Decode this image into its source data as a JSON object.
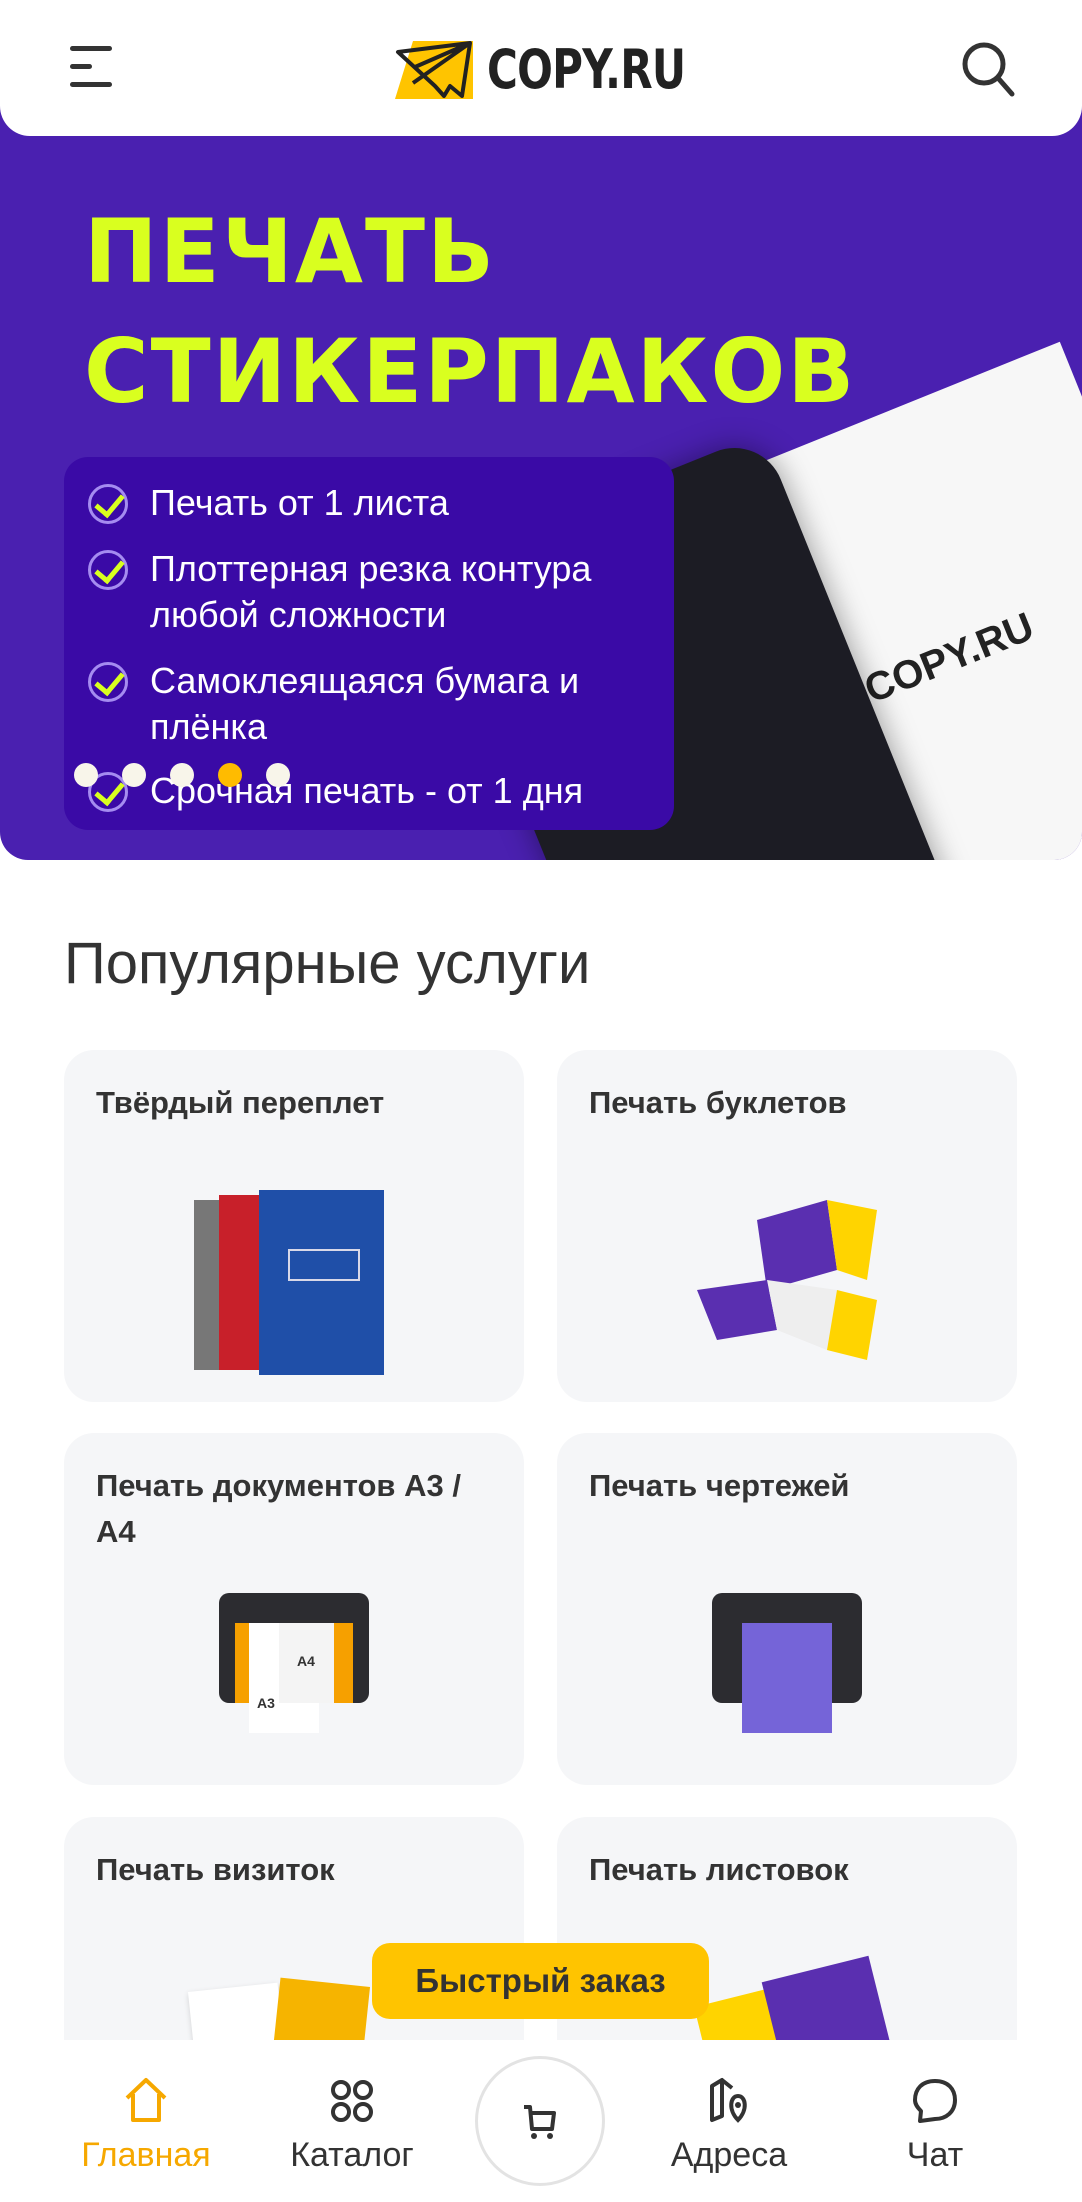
{
  "header": {
    "logo_text": "COPY.RU",
    "menu_icon": "hamburger-icon",
    "search_icon": "search-icon"
  },
  "banner": {
    "title_line1": "ПЕЧАТЬ",
    "title_line2": "СТИКЕРПАКОВ",
    "features": [
      "Печать от 1 листа",
      "Плоттерная резка контура любой сложности",
      "Самоклеящаяся бумага и плёнка",
      "Срочная печать - от 1 дня"
    ],
    "sheet_logo": "COPY.RU",
    "slides_count": 5,
    "active_slide": 4,
    "colors": {
      "background": "#4a20b0",
      "title": "#d9ff1f",
      "active_dot": "#ffbb00"
    }
  },
  "popular": {
    "title": "Популярные услуги",
    "cards": [
      {
        "title": "Твёрдый переплет"
      },
      {
        "title": "Печать буклетов"
      },
      {
        "title": "Печать документов А3 / А4"
      },
      {
        "title": "Печать чертежей"
      },
      {
        "title": "Печать визиток"
      },
      {
        "title": "Печать листовок"
      }
    ],
    "printer_labels": {
      "a4": "A4",
      "a3": "A3"
    }
  },
  "quick_order": {
    "label": "Быстрый заказ",
    "color": "#ffc400"
  },
  "nav": {
    "items": [
      {
        "label": "Главная",
        "icon": "home-icon",
        "active": true
      },
      {
        "label": "Каталог",
        "icon": "grid-icon"
      },
      {
        "label": "Адреса",
        "icon": "map-pin-icon"
      },
      {
        "label": "Чат",
        "icon": "chat-icon"
      }
    ],
    "cart_icon": "cart-icon",
    "active_color": "#f6a800"
  }
}
